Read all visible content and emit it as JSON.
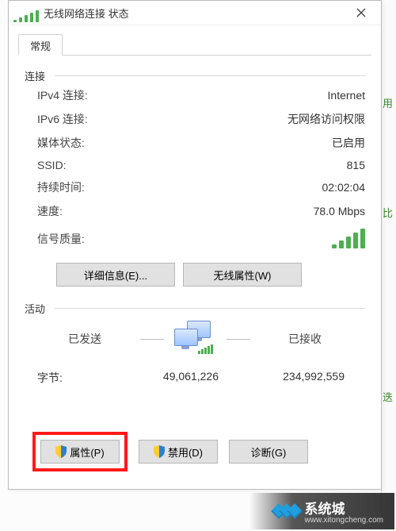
{
  "window": {
    "title": "无线网络连接 状态",
    "tab_general": "常规"
  },
  "connection": {
    "section_title": "连接",
    "ipv4_label": "IPv4 连接:",
    "ipv4_value": "Internet",
    "ipv6_label": "IPv6 连接:",
    "ipv6_value": "无网络访问权限",
    "media_label": "媒体状态:",
    "media_value": "已启用",
    "ssid_label": "SSID:",
    "ssid_value": "815",
    "duration_label": "持续时间:",
    "duration_value": "02:02:04",
    "speed_label": "速度:",
    "speed_value": "78.0 Mbps",
    "signal_label": "信号质量:"
  },
  "buttons": {
    "details": "详细信息(E)...",
    "wireless_props": "无线属性(W)",
    "properties": "属性(P)",
    "disable": "禁用(D)",
    "diagnose": "诊断(G)"
  },
  "activity": {
    "section_title": "活动",
    "sent_label": "已发送",
    "received_label": "已接收",
    "bytes_label": "字节:",
    "bytes_sent": "49,061,226",
    "bytes_received": "234,992,559"
  },
  "watermark": {
    "brand": "系统城",
    "url": "www.xitongcheng.com"
  },
  "side_markers": [
    "用",
    "比",
    "迭"
  ]
}
